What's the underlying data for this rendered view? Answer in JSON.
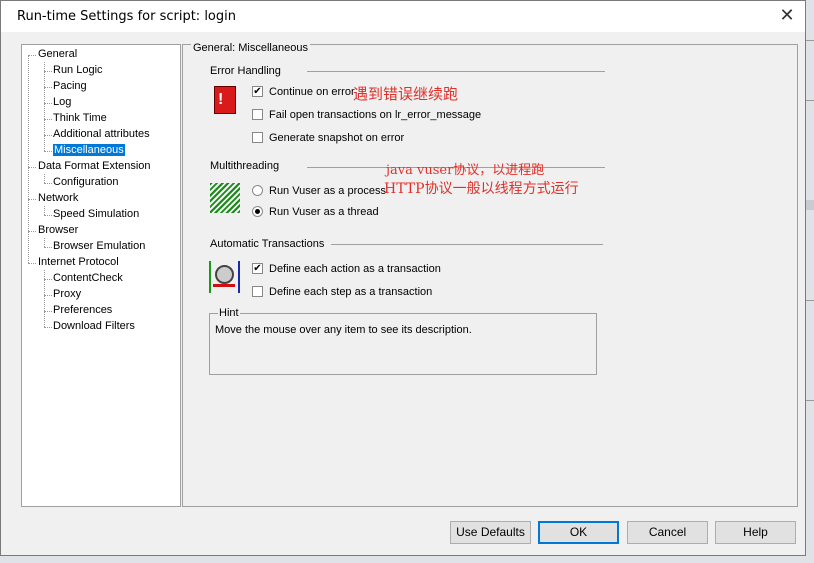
{
  "window": {
    "title": "Run-time Settings for script: login"
  },
  "tree": [
    {
      "label": "General",
      "level": 0
    },
    {
      "label": "Run Logic",
      "level": 1
    },
    {
      "label": "Pacing",
      "level": 1
    },
    {
      "label": "Log",
      "level": 1
    },
    {
      "label": "Think Time",
      "level": 1
    },
    {
      "label": "Additional attributes",
      "level": 1
    },
    {
      "label": "Miscellaneous",
      "level": 1,
      "selected": true
    },
    {
      "label": "Data Format Extension",
      "level": 0
    },
    {
      "label": "Configuration",
      "level": 1
    },
    {
      "label": "Network",
      "level": 0
    },
    {
      "label": "Speed Simulation",
      "level": 1
    },
    {
      "label": "Browser",
      "level": 0
    },
    {
      "label": "Browser Emulation",
      "level": 1
    },
    {
      "label": "Internet Protocol",
      "level": 0
    },
    {
      "label": "ContentCheck",
      "level": 1
    },
    {
      "label": "Proxy",
      "level": 1
    },
    {
      "label": "Preferences",
      "level": 1
    },
    {
      "label": "Download Filters",
      "level": 1
    }
  ],
  "panel": {
    "group_title": "General: Miscellaneous",
    "error_handling": {
      "title": "Error Handling",
      "continue_on_error": "Continue on error",
      "fail_open": "Fail open transactions on lr_error_message",
      "snapshot": "Generate snapshot on error",
      "annotation": "遇到错误继续跑"
    },
    "multithreading": {
      "title": "Multithreading",
      "process": "Run Vuser as a process",
      "thread": "Run Vuser as a thread",
      "selected": "thread",
      "annotation_1": "java vuser协议，以进程跑",
      "annotation_2": "HTTP协议一般以线程方式运行"
    },
    "auto_transactions": {
      "title": "Automatic Transactions",
      "action": "Define each action as a transaction",
      "step": "Define each step as a transaction"
    },
    "hint": {
      "title": "Hint",
      "text": "Move the mouse over any item to see its description."
    }
  },
  "buttons": {
    "use_defaults": "Use Defaults",
    "ok": "OK",
    "cancel": "Cancel",
    "help": "Help"
  }
}
